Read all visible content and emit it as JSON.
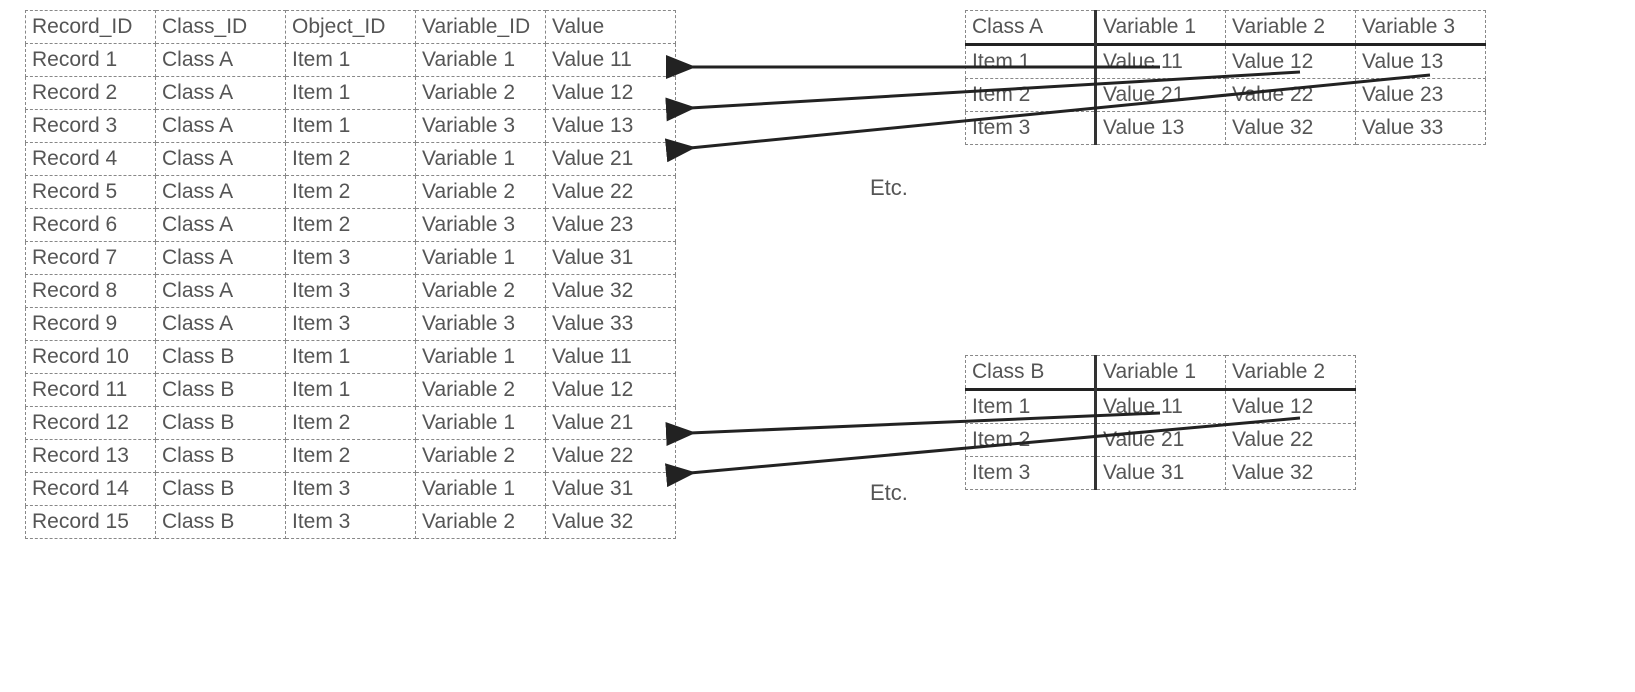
{
  "left_table": {
    "headers": [
      "Record_ID",
      "Class_ID",
      "Object_ID",
      "Variable_ID",
      "Value"
    ],
    "rows": [
      [
        "Record 1",
        "Class A",
        "Item 1",
        "Variable 1",
        "Value 11"
      ],
      [
        "Record 2",
        "Class A",
        "Item 1",
        "Variable 2",
        "Value 12"
      ],
      [
        "Record 3",
        "Class A",
        "Item 1",
        "Variable 3",
        "Value 13"
      ],
      [
        "Record 4",
        "Class A",
        "Item 2",
        "Variable 1",
        "Value 21"
      ],
      [
        "Record 5",
        "Class A",
        "Item 2",
        "Variable 2",
        "Value 22"
      ],
      [
        "Record 6",
        "Class A",
        "Item 2",
        "Variable 3",
        "Value 23"
      ],
      [
        "Record 7",
        "Class A",
        "Item 3",
        "Variable 1",
        "Value 31"
      ],
      [
        "Record 8",
        "Class A",
        "Item 3",
        "Variable 2",
        "Value 32"
      ],
      [
        "Record 9",
        "Class A",
        "Item 3",
        "Variable 3",
        "Value 33"
      ],
      [
        "Record 10",
        "Class B",
        "Item 1",
        "Variable 1",
        "Value 11"
      ],
      [
        "Record 11",
        "Class B",
        "Item 1",
        "Variable 2",
        "Value 12"
      ],
      [
        "Record 12",
        "Class B",
        "Item 2",
        "Variable 1",
        "Value 21"
      ],
      [
        "Record 13",
        "Class B",
        "Item 2",
        "Variable 2",
        "Value 22"
      ],
      [
        "Record 14",
        "Class B",
        "Item 3",
        "Variable 1",
        "Value 31"
      ],
      [
        "Record 15",
        "Class B",
        "Item 3",
        "Variable 2",
        "Value 32"
      ]
    ]
  },
  "right_table_a": {
    "headers": [
      "Class A",
      "Variable 1",
      "Variable 2",
      "Variable 3"
    ],
    "rows": [
      [
        "Item 1",
        "Value 11",
        "Value 12",
        "Value 13"
      ],
      [
        "Item 2",
        "Value 21",
        "Value 22",
        "Value 23"
      ],
      [
        "Item 3",
        "Value 13",
        "Value 32",
        "Value 33"
      ]
    ]
  },
  "right_table_b": {
    "headers": [
      "Class B",
      "Variable 1",
      "Variable 2"
    ],
    "rows": [
      [
        "Item 1",
        "Value 11",
        "Value 12"
      ],
      [
        "Item 2",
        "Value 21",
        "Value 22"
      ],
      [
        "Item 3",
        "Value 31",
        "Value 32"
      ]
    ]
  },
  "etc_label_a": "Etc.",
  "etc_label_b": "Etc."
}
